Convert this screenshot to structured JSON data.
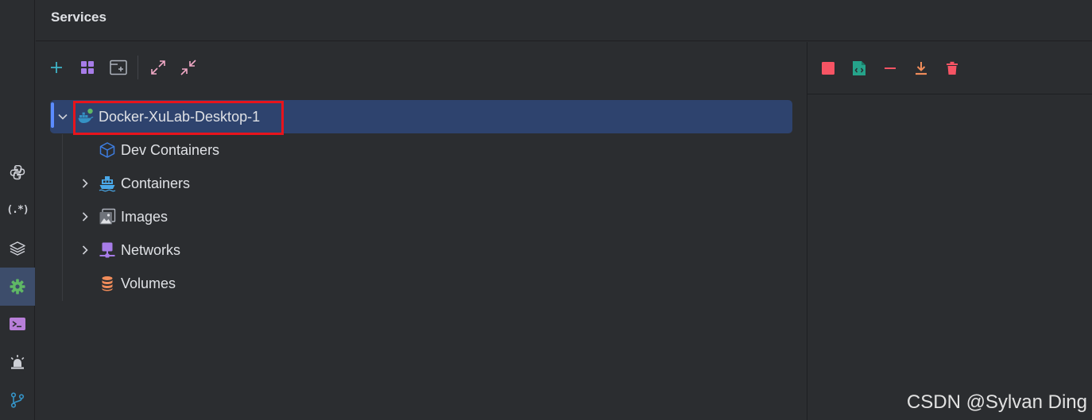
{
  "header": {
    "title": "Services"
  },
  "activity_bar": {
    "items": [
      {
        "icon": "python-icon"
      },
      {
        "icon": "regex-icon",
        "glyph": "(.*)"
      },
      {
        "icon": "layers-icon"
      },
      {
        "icon": "gear-icon",
        "active": true
      },
      {
        "icon": "terminal-icon"
      },
      {
        "icon": "alarm-icon"
      },
      {
        "icon": "git-branch-icon"
      }
    ]
  },
  "toolbar": {
    "items": [
      "add-icon",
      "group-icon",
      "new-tab-icon",
      "expand-all-icon",
      "collapse-all-icon"
    ]
  },
  "tree": {
    "root": {
      "label": "Docker-XuLab-Desktop-1",
      "expanded": true,
      "selected": true,
      "icon": "docker-icon"
    },
    "children": [
      {
        "label": "Dev Containers",
        "icon": "cube-icon",
        "expandable": false
      },
      {
        "label": "Containers",
        "icon": "container-ship-icon",
        "expandable": true
      },
      {
        "label": "Images",
        "icon": "image-icon",
        "expandable": true
      },
      {
        "label": "Networks",
        "icon": "network-icon",
        "expandable": true
      },
      {
        "label": "Volumes",
        "icon": "database-icon",
        "expandable": false
      }
    ]
  },
  "detail_toolbar": {
    "items": [
      "stop-icon",
      "edit-config-icon",
      "remove-icon",
      "download-icon",
      "delete-icon"
    ]
  },
  "colors": {
    "background": "#2b2d30",
    "selection": "#2e436e",
    "accent": "#5b8cff",
    "highlight_box": "#e8141c",
    "danger": "#f75464",
    "success": "#5fb865"
  },
  "watermark": "CSDN @Sylvan Ding"
}
